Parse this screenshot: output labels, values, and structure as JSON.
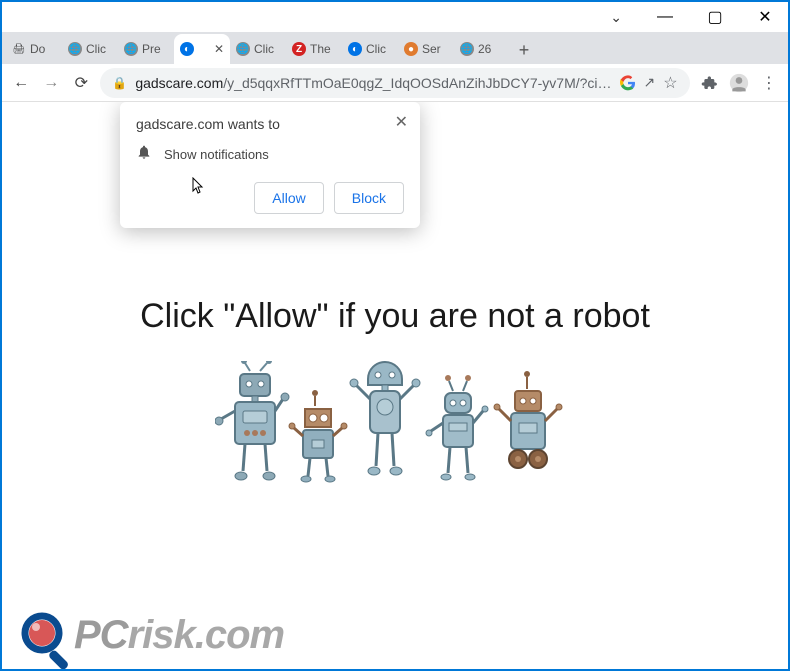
{
  "titlebar": {
    "caret": "⌄",
    "min": "—",
    "max": "▢",
    "close": "✕"
  },
  "tabs": [
    {
      "label": "Do",
      "fav": "printer"
    },
    {
      "label": "Clic",
      "fav": "globe"
    },
    {
      "label": "Pre",
      "fav": "globe"
    },
    {
      "label": "",
      "fav": "blue",
      "active": true
    },
    {
      "label": "Clic",
      "fav": "globe"
    },
    {
      "label": "The",
      "fav": "red"
    },
    {
      "label": "Clic",
      "fav": "blue"
    },
    {
      "label": "Ser",
      "fav": "orange"
    },
    {
      "label": "26",
      "fav": "globe"
    }
  ],
  "newtab": "+",
  "toolbar": {
    "back": "←",
    "forward": "→",
    "reload": "⟳",
    "lock": "🔒",
    "url_domain": "gadscare.com",
    "url_path": "/y_d5qqxRfTTmOaE0qgZ_IdqOOSdAnZihJbDCY7-yv7M/?ci…",
    "g_icon": "G",
    "share": "↗",
    "star": "☆",
    "puzzle": "✦",
    "profile": "👤",
    "menu": "⋮"
  },
  "permission": {
    "title": "gadscare.com wants to",
    "text": "Show notifications",
    "allow": "Allow",
    "block": "Block",
    "close": "✕",
    "bell": "🔔"
  },
  "page": {
    "message": "Click \"Allow\"   if you are not   a robot"
  },
  "watermark": {
    "text_pc": "PC",
    "text_rest": "risk.com"
  },
  "colors": {
    "frame": "#0078d7",
    "link_blue": "#1a73e8",
    "robot_blue": "#9ab8c6",
    "robot_brown": "#a8795b"
  }
}
